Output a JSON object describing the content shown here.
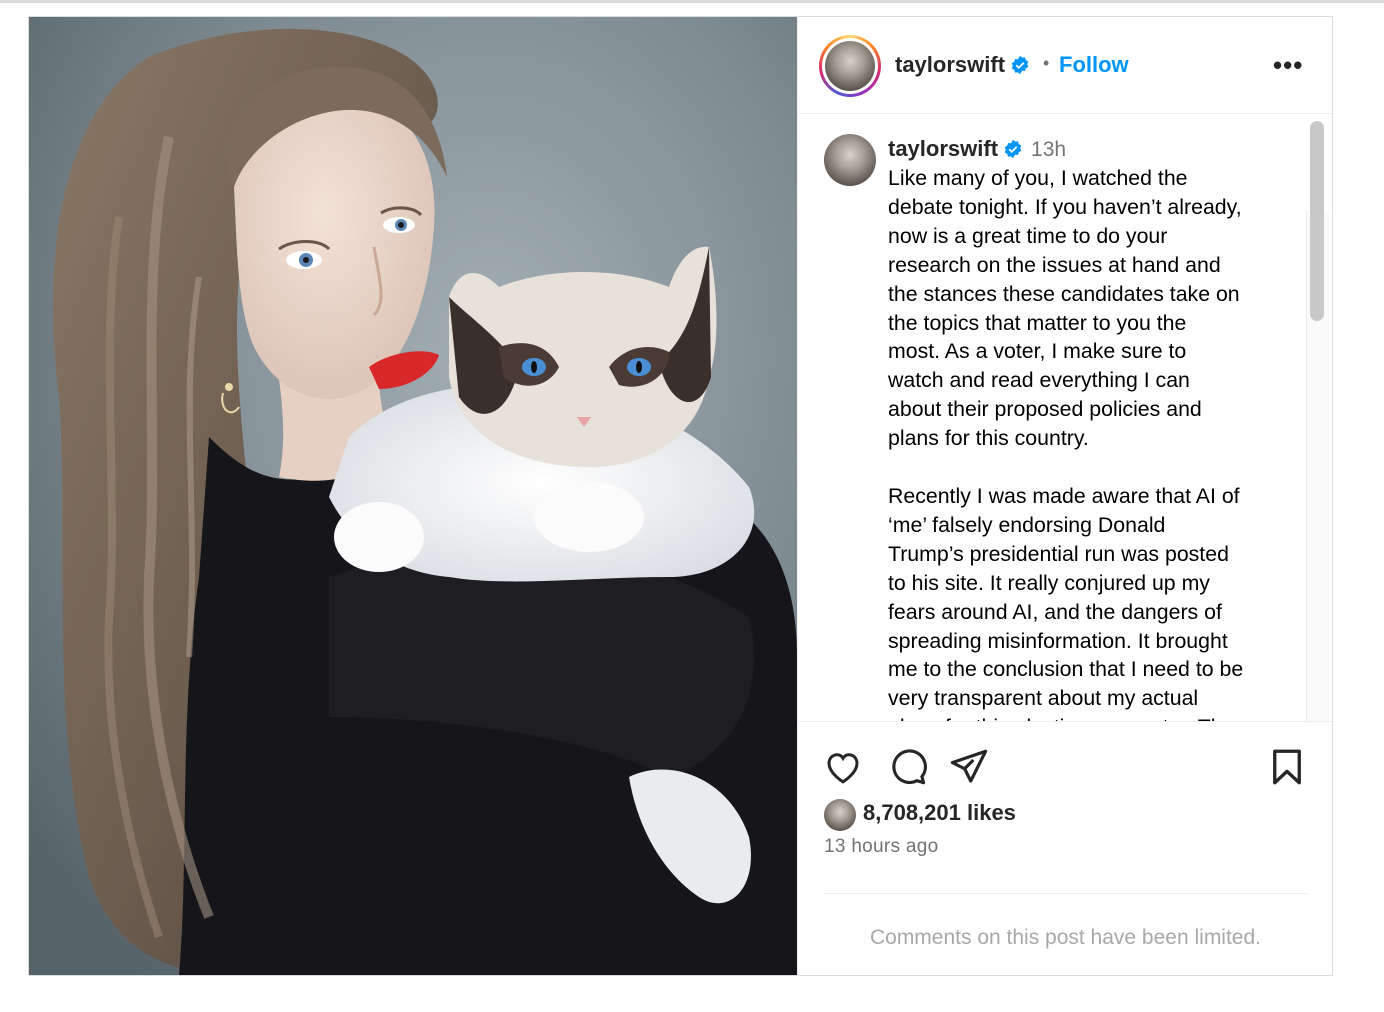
{
  "post": {
    "username": "taylorswift",
    "follow_label": "Follow",
    "separator": "•",
    "more_label": "•••",
    "time_short": "13h",
    "caption": "Like many of you, I watched the\ndebate tonight. If you haven’t already,\nnow is a great time to do your\nresearch on the issues at hand and\nthe stances these candidates take on\nthe topics that matter to you the\nmost. As a voter, I make sure to\nwatch and read everything I can\nabout their proposed policies and\nplans for this country.\n\nRecently I was made aware that AI of\n‘me’ falsely endorsing Donald\nTrump’s presidential run was posted\nto his site. It really conjured up my\nfears around AI, and the dangers of\nspreading misinformation. It brought\nme to the conclusion that I need to be\nvery transparent about my actual\nplans for this election as a voter. The",
    "likes": "8,708,201 likes",
    "time_ago": "13 hours ago",
    "comments_notice": "Comments on this post have been limited."
  },
  "colors": {
    "link_blue": "#0095f6",
    "verified_blue": "#0095f6",
    "secondary_text": "#737373",
    "border": "#dbdbdb"
  },
  "icons": [
    "verified-badge-icon",
    "more-options-icon",
    "heart-icon",
    "comment-icon",
    "share-icon",
    "bookmark-icon"
  ]
}
